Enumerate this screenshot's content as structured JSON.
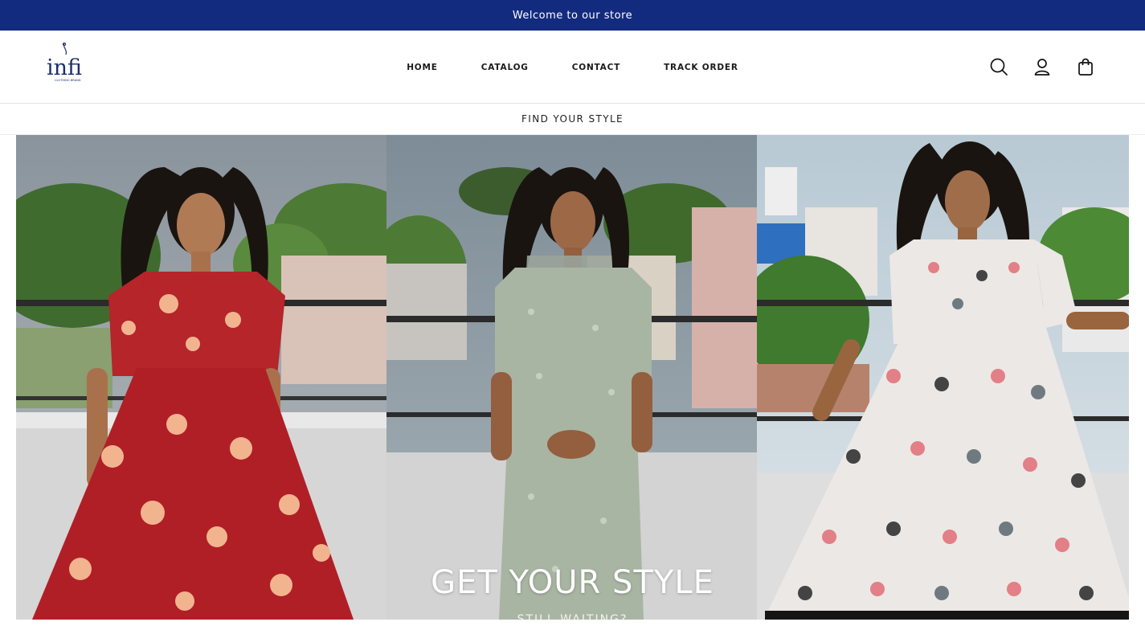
{
  "announcement": {
    "text": "Welcome to our store",
    "bg_color": "#132b7f"
  },
  "brand": {
    "logo_text": "infi",
    "tagline": "CLOTHING BRAND"
  },
  "nav": {
    "items": [
      {
        "label": "HOME"
      },
      {
        "label": "CATALOG"
      },
      {
        "label": "CONTACT"
      },
      {
        "label": "TRACK ORDER"
      }
    ]
  },
  "header_icons": [
    "search-icon",
    "account-icon",
    "cart-icon"
  ],
  "subbar": {
    "text": "FIND YOUR STYLE"
  },
  "hero": {
    "heading": "GET YOUR STYLE",
    "subheading": "STILL WAITING?",
    "panels": [
      {
        "label": "red-floral-dress-photo"
      },
      {
        "label": "sage-green-kurta-photo"
      },
      {
        "label": "elephant-print-dress-photo"
      }
    ]
  }
}
